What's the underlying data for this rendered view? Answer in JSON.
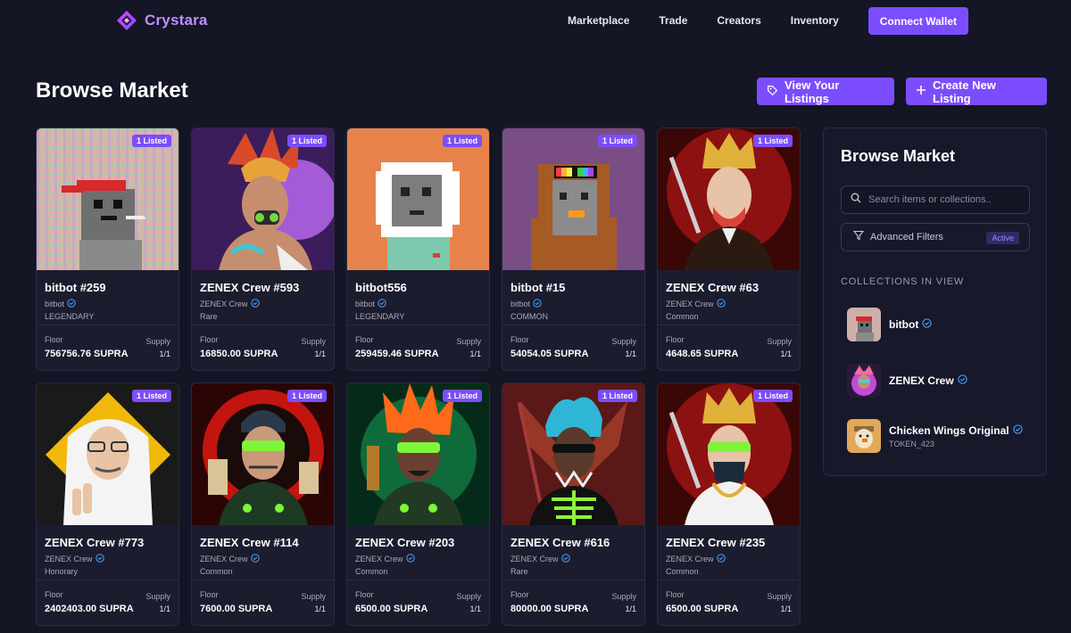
{
  "brand": {
    "name": "Crystara",
    "color": "#c08cff"
  },
  "nav": {
    "links": [
      "Marketplace",
      "Trade",
      "Creators",
      "Inventory"
    ],
    "connect_label": "Connect Wallet"
  },
  "page": {
    "title": "Browse Market",
    "view_listings_label": "View Your Listings",
    "create_listing_label": "Create New Listing"
  },
  "labels": {
    "floor": "Floor",
    "supply": "Supply"
  },
  "cards": [
    {
      "name": "bitbot #259",
      "collection": "bitbot",
      "rarity": "LEGENDARY",
      "badge": "1 Listed",
      "floor": "756756.76 SUPRA",
      "supply": "1/1",
      "art": "bitbot-red-cap"
    },
    {
      "name": "ZENEX Crew #593",
      "collection": "ZENEX Crew",
      "rarity": "Rare",
      "badge": "1 Listed",
      "floor": "16850.00 SUPRA",
      "supply": "1/1",
      "art": "zenex-feather-headdress"
    },
    {
      "name": "bitbot556",
      "collection": "bitbot",
      "rarity": "LEGENDARY",
      "badge": "1 Listed",
      "floor": "259459.46 SUPRA",
      "supply": "1/1",
      "art": "bitbot-astronaut"
    },
    {
      "name": "bitbot #15",
      "collection": "bitbot",
      "rarity": "COMMON",
      "badge": "1 Listed",
      "floor": "54054.05 SUPRA",
      "supply": "1/1",
      "art": "bitbot-rainbow-shades"
    },
    {
      "name": "ZENEX Crew #63",
      "collection": "ZENEX Crew",
      "rarity": "Common",
      "badge": "1 Listed",
      "floor": "4648.65 SUPRA",
      "supply": "1/1",
      "art": "zenex-gold-crown"
    },
    {
      "name": "ZENEX Crew #773",
      "collection": "ZENEX Crew",
      "rarity": "Honorary",
      "badge": "1 Listed",
      "floor": "2402403.00 SUPRA",
      "supply": "1/1",
      "art": "zenex-keffiyeh"
    },
    {
      "name": "ZENEX Crew #114",
      "collection": "ZENEX Crew",
      "rarity": "Common",
      "badge": "1 Listed",
      "floor": "7600.00 SUPRA",
      "supply": "1/1",
      "art": "zenex-green-visor-red"
    },
    {
      "name": "ZENEX Crew #203",
      "collection": "ZENEX Crew",
      "rarity": "Common",
      "badge": "1 Listed",
      "floor": "6500.00 SUPRA",
      "supply": "1/1",
      "art": "zenex-fire-hair"
    },
    {
      "name": "ZENEX Crew #616",
      "collection": "ZENEX Crew",
      "rarity": "Rare",
      "badge": "1 Listed",
      "floor": "80000.00 SUPRA",
      "supply": "1/1",
      "art": "zenex-blue-hair-skeleton"
    },
    {
      "name": "ZENEX Crew #235",
      "collection": "ZENEX Crew",
      "rarity": "Common",
      "badge": "1 Listed",
      "floor": "6500.00 SUPRA",
      "supply": "1/1",
      "art": "zenex-crown-mask"
    }
  ],
  "sidebar": {
    "title": "Browse Market",
    "search_placeholder": "Search items or collections..",
    "filters_label": "Advanced Filters",
    "filters_status": "Active",
    "collections_header": "COLLECTIONS IN VIEW",
    "collections": [
      {
        "name": "bitbot",
        "sub": ""
      },
      {
        "name": "ZENEX Crew",
        "sub": ""
      },
      {
        "name": "Chicken Wings Original",
        "sub": "TOKEN_423"
      }
    ]
  },
  "colors": {
    "accent": "#7c4dff",
    "background": "#141525",
    "card": "#1b1c2e",
    "verified": "#4da3ff"
  },
  "icons": [
    "crystara-logo-icon",
    "tag-icon",
    "plus-icon",
    "search-icon",
    "filter-icon",
    "verified-icon"
  ]
}
